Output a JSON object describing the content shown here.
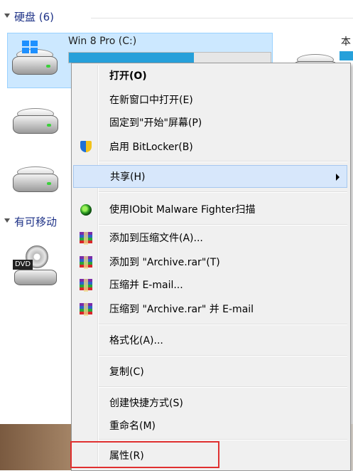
{
  "explorer": {
    "hard_disks_header": "硬盘 (6)",
    "removable_header": "有可移动",
    "drive_c": {
      "name": "Win 8 Pro (C:)",
      "usage": 0.62
    },
    "partial_right_name": "本",
    "dvd_label": "DVD",
    "accent_color": "#26a0da"
  },
  "menu": {
    "items": [
      {
        "label": "打开(O)",
        "bold": true
      },
      {
        "label": "在新窗口中打开(E)"
      },
      {
        "label": "固定到\"开始\"屏幕(P)"
      },
      {
        "label": "启用 BitLocker(B)",
        "icon": "shield-icon"
      },
      {
        "label": "共享(H)",
        "submenu": true,
        "highlighted": true
      },
      {
        "label": "使用IObit Malware Fighter扫描",
        "icon": "iobit-icon"
      },
      {
        "label": "添加到压缩文件(A)...",
        "icon": "winrar-icon"
      },
      {
        "label": "添加到 \"Archive.rar\"(T)",
        "icon": "winrar-icon"
      },
      {
        "label": "压缩并 E-mail...",
        "icon": "winrar-icon"
      },
      {
        "label": "压缩到 \"Archive.rar\" 并 E-mail",
        "icon": "winrar-icon"
      },
      {
        "label": "格式化(A)..."
      },
      {
        "label": "复制(C)"
      },
      {
        "label": "创建快捷方式(S)"
      },
      {
        "label": "重命名(M)"
      },
      {
        "label": "属性(R)",
        "outlined": true
      }
    ]
  }
}
